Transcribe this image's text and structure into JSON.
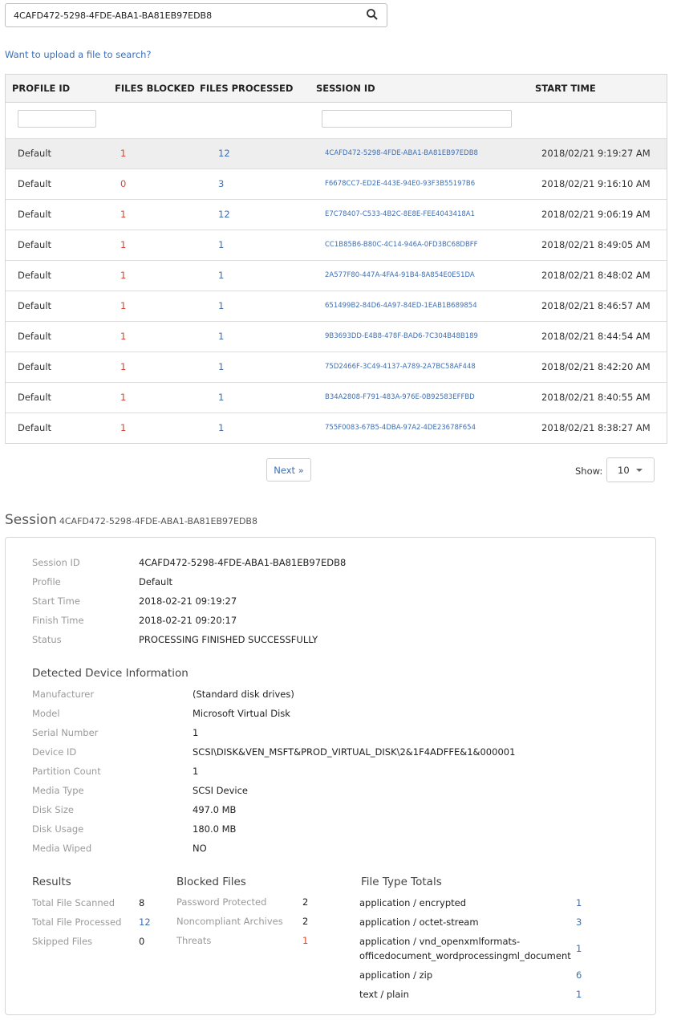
{
  "search": {
    "value": "4CAFD472-5298-4FDE-ABA1-BA81EB97EDB8",
    "icon": "search-icon"
  },
  "upload_link": "Want to upload a file to search?",
  "table": {
    "headers": [
      "PROFILE ID",
      "FILES BLOCKED",
      "FILES PROCESSED",
      "SESSION ID",
      "START TIME"
    ],
    "rows": [
      {
        "profile": "Default",
        "blocked": "1",
        "processed": "12",
        "session": "4CAFD472-5298-4FDE-ABA1-BA81EB97EDB8",
        "start": "2018/02/21 9:19:27 AM"
      },
      {
        "profile": "Default",
        "blocked": "0",
        "processed": "3",
        "session": "F6678CC7-ED2E-443E-94E0-93F3B55197B6",
        "start": "2018/02/21 9:16:10 AM"
      },
      {
        "profile": "Default",
        "blocked": "1",
        "processed": "12",
        "session": "E7C78407-C533-4B2C-8E8E-FEE4043418A1",
        "start": "2018/02/21 9:06:19 AM"
      },
      {
        "profile": "Default",
        "blocked": "1",
        "processed": "1",
        "session": "CC1B85B6-B80C-4C14-946A-0FD3BC68DBFF",
        "start": "2018/02/21 8:49:05 AM"
      },
      {
        "profile": "Default",
        "blocked": "1",
        "processed": "1",
        "session": "2A577F80-447A-4FA4-91B4-8A854E0E51DA",
        "start": "2018/02/21 8:48:02 AM"
      },
      {
        "profile": "Default",
        "blocked": "1",
        "processed": "1",
        "session": "651499B2-84D6-4A97-84ED-1EAB1B689854",
        "start": "2018/02/21 8:46:57 AM"
      },
      {
        "profile": "Default",
        "blocked": "1",
        "processed": "1",
        "session": "9B3693DD-E4B8-478F-BAD6-7C304B48B189",
        "start": "2018/02/21 8:44:54 AM"
      },
      {
        "profile": "Default",
        "blocked": "1",
        "processed": "1",
        "session": "75D2466F-3C49-4137-A789-2A7BC58AF448",
        "start": "2018/02/21 8:42:20 AM"
      },
      {
        "profile": "Default",
        "blocked": "1",
        "processed": "1",
        "session": "B34A2808-F791-483A-976E-0B92583EFFBD",
        "start": "2018/02/21 8:40:55 AM"
      },
      {
        "profile": "Default",
        "blocked": "1",
        "processed": "1",
        "session": "755F0083-67B5-4DBA-97A2-4DE23678F654",
        "start": "2018/02/21 8:38:27 AM"
      }
    ]
  },
  "pager": {
    "next": "Next »",
    "show_label": "Show:",
    "show_value": "10"
  },
  "session": {
    "title": "Session",
    "id": "4CAFD472-5298-4FDE-ABA1-BA81EB97EDB8",
    "fields": [
      {
        "label": "Session ID",
        "value": "4CAFD472-5298-4FDE-ABA1-BA81EB97EDB8"
      },
      {
        "label": "Profile",
        "value": "Default"
      },
      {
        "label": "Start Time",
        "value": "2018-02-21 09:19:27"
      },
      {
        "label": "Finish Time",
        "value": "2018-02-21 09:20:17"
      },
      {
        "label": "Status",
        "value": "PROCESSING FINISHED SUCCESSFULLY"
      }
    ]
  },
  "device": {
    "title": "Detected Device Information",
    "fields": [
      {
        "label": "Manufacturer",
        "value": "(Standard disk drives)"
      },
      {
        "label": "Model",
        "value": "Microsoft Virtual Disk"
      },
      {
        "label": "Serial Number",
        "value": "1"
      },
      {
        "label": "Device ID",
        "value": "SCSI\\DISK&VEN_MSFT&PROD_VIRTUAL_DISK\\2&1F4ADFFE&1&000001"
      },
      {
        "label": "Partition Count",
        "value": "1"
      },
      {
        "label": "Media Type",
        "value": "SCSI Device"
      },
      {
        "label": "Disk Size",
        "value": "497.0 MB"
      },
      {
        "label": "Disk Usage",
        "value": "180.0 MB"
      },
      {
        "label": "Media Wiped",
        "value": "NO"
      }
    ]
  },
  "results": {
    "title": "Results",
    "items": [
      {
        "label": "Total File Scanned",
        "value": "8"
      },
      {
        "label": "Total File Processed",
        "value": "12"
      },
      {
        "label": "Skipped Files",
        "value": "0"
      }
    ]
  },
  "blocked": {
    "title": "Blocked Files",
    "items": [
      {
        "label": "Password Protected",
        "value": "2"
      },
      {
        "label": "Noncompliant Archives",
        "value": "2"
      },
      {
        "label": "Threats",
        "value": "1"
      }
    ]
  },
  "file_types": {
    "title": "File Type Totals",
    "items": [
      {
        "type": "application / encrypted",
        "count": "1"
      },
      {
        "type": "application / octet-stream",
        "count": "3"
      },
      {
        "type": "application / vnd_openxmlformats-officedocument_wordprocessingml_document",
        "count": "1"
      },
      {
        "type": "application / zip",
        "count": "6"
      },
      {
        "type": "text / plain",
        "count": "1"
      }
    ]
  },
  "colors": {
    "link": "#3d6fb5",
    "blocked": "#d9432f",
    "label": "#9a9a9a"
  }
}
